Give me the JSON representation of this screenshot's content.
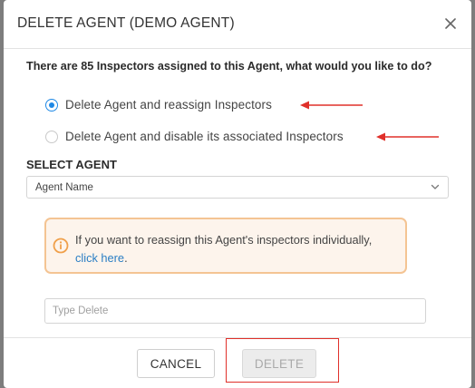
{
  "modal": {
    "title": "DELETE AGENT (DEMO AGENT)",
    "close_glyph": "×",
    "question": "There are 85 Inspectors assigned to this Agent, what would you like to do?"
  },
  "options": [
    {
      "label": "Delete Agent and reassign Inspectors",
      "selected": true
    },
    {
      "label": "Delete Agent and disable its associated Inspectors",
      "selected": false
    }
  ],
  "select_agent": {
    "title": "SELECT AGENT",
    "value": "Agent Name",
    "icon": "chevron-down-icon"
  },
  "info": {
    "text": "If you want to reassign this Agent's inspectors individually,",
    "link": "click here",
    "suffix": ".",
    "icon": "info-icon",
    "border_color": "#f4c493",
    "background_color": "#fdf4ec"
  },
  "confirm": {
    "placeholder": "Type Delete",
    "value": ""
  },
  "footer": {
    "cancel_label": "CANCEL",
    "delete_label": "DELETE"
  },
  "colors": {
    "accent": "#1e88e5",
    "annotation_red": "#e0302a",
    "link": "#2a7ec4"
  }
}
